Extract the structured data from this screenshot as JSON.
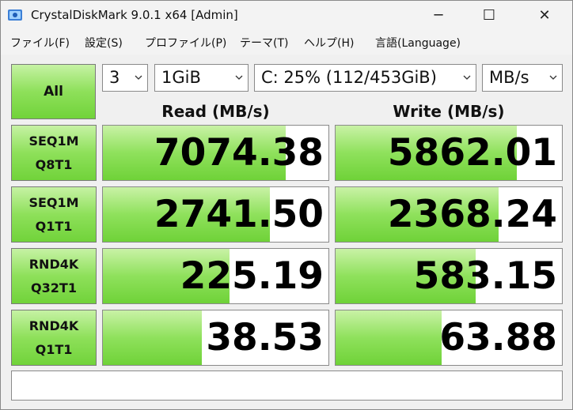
{
  "window": {
    "title": "CrystalDiskMark 9.0.1 x64 [Admin]",
    "controls": {
      "minimize": "─",
      "maximize": "☐",
      "close": "✕"
    }
  },
  "menu": {
    "items": [
      "ファイル(F)",
      "設定(S)",
      "プロファイル(P)",
      "テーマ(T)",
      "ヘルプ(H)",
      "言語(Language)"
    ]
  },
  "toolbar": {
    "all_label": "All",
    "count_value": "3",
    "size_value": "1GiB",
    "drive_value": "C: 25% (112/453GiB)",
    "unit_value": "MB/s"
  },
  "columns": {
    "read": "Read (MB/s)",
    "write": "Write (MB/s)"
  },
  "tests": [
    {
      "line1": "SEQ1M",
      "line2": "Q8T1",
      "read": "7074.38",
      "write": "5862.01",
      "read_fill": 0.81,
      "write_fill": 0.8
    },
    {
      "line1": "SEQ1M",
      "line2": "Q1T1",
      "read": "2741.50",
      "write": "2368.24",
      "read_fill": 0.74,
      "write_fill": 0.72
    },
    {
      "line1": "RND4K",
      "line2": "Q32T1",
      "read": "225.19",
      "write": "583.15",
      "read_fill": 0.56,
      "write_fill": 0.62
    },
    {
      "line1": "RND4K",
      "line2": "Q1T1",
      "read": "38.53",
      "write": "63.88",
      "read_fill": 0.44,
      "write_fill": 0.47
    }
  ],
  "comment": "",
  "colors": {
    "bar_green": "#8ee05a",
    "title_bg": "#f3f3f3",
    "window_bg": "#f0f0f0"
  }
}
